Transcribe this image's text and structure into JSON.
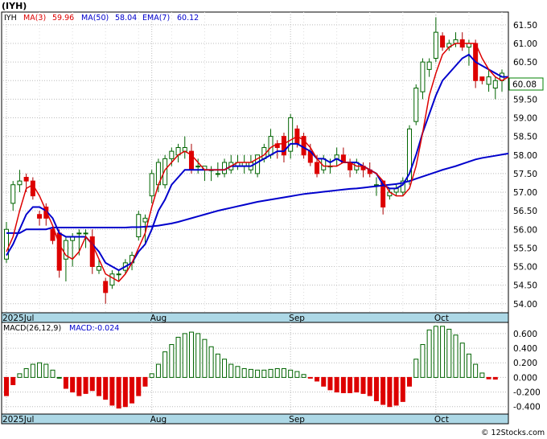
{
  "chart_data": [
    {
      "type": "candlestick",
      "title": "(IYH)",
      "indicators": {
        "symbol": "IYH",
        "ma3_label": "MA(3)",
        "ma3_value": "59.96",
        "ma50_label": "MA(50)",
        "ma50_value": "58.04",
        "ema7_label": "EMA(7)",
        "ema7_value": "60.12"
      },
      "last_price_label": "60.08",
      "x_labels": [
        "2025Jul",
        "Aug",
        "Sep",
        "Oct"
      ],
      "ylim": [
        53.8,
        61.8
      ],
      "yticks": [
        "61.50",
        "61.00",
        "60.50",
        "60.00",
        "59.50",
        "59.00",
        "58.50",
        "58.00",
        "57.50",
        "57.00",
        "56.50",
        "56.00",
        "55.50",
        "55.00",
        "54.50",
        "54.00"
      ],
      "colors": {
        "up": "#006400",
        "down": "#dd0000",
        "ma3": "#dd0000",
        "ema7": "#0000cc",
        "ma50": "#0000cc",
        "accent": "#add8e6"
      },
      "candles": [
        {
          "date": "Jul 01",
          "open": 55.2,
          "high": 56.2,
          "low": 55.1,
          "close": 56.0
        },
        {
          "date": "Jul 02",
          "open": 56.7,
          "high": 57.3,
          "low": 56.5,
          "close": 57.2
        },
        {
          "date": "Jul 03",
          "open": 57.2,
          "high": 57.6,
          "low": 57.0,
          "close": 57.3
        },
        {
          "date": "Jul 07",
          "open": 57.4,
          "high": 57.5,
          "low": 57.0,
          "close": 57.3
        },
        {
          "date": "Jul 08",
          "open": 57.3,
          "high": 57.4,
          "low": 56.8,
          "close": 56.9
        },
        {
          "date": "Jul 09",
          "open": 56.4,
          "high": 56.5,
          "low": 56.1,
          "close": 56.3
        },
        {
          "date": "Jul 10",
          "open": 56.6,
          "high": 56.7,
          "low": 56.1,
          "close": 56.3
        },
        {
          "date": "Jul 11",
          "open": 56.0,
          "high": 56.1,
          "low": 55.6,
          "close": 55.7
        },
        {
          "date": "Jul 14",
          "open": 55.9,
          "high": 56.0,
          "low": 54.7,
          "close": 54.9
        },
        {
          "date": "Jul 15",
          "open": 55.2,
          "high": 55.8,
          "low": 54.6,
          "close": 55.7
        },
        {
          "date": "Jul 16",
          "open": 55.7,
          "high": 55.9,
          "low": 55.0,
          "close": 55.8
        },
        {
          "date": "Jul 17",
          "open": 55.9,
          "high": 56.0,
          "low": 55.3,
          "close": 55.9
        },
        {
          "date": "Jul 18",
          "open": 55.9,
          "high": 56.0,
          "low": 55.5,
          "close": 55.9
        },
        {
          "date": "Jul 21",
          "open": 55.8,
          "high": 56.0,
          "low": 54.8,
          "close": 55.0
        },
        {
          "date": "Jul 22",
          "open": 54.9,
          "high": 55.2,
          "low": 54.8,
          "close": 55.0
        },
        {
          "date": "Jul 23",
          "open": 54.6,
          "high": 54.7,
          "low": 54.0,
          "close": 54.3
        },
        {
          "date": "Jul 24",
          "open": 54.5,
          "high": 54.9,
          "low": 54.4,
          "close": 54.8
        },
        {
          "date": "Jul 25",
          "open": 54.8,
          "high": 54.9,
          "low": 54.6,
          "close": 54.8
        },
        {
          "date": "Jul 28",
          "open": 54.9,
          "high": 55.2,
          "low": 54.8,
          "close": 55.1
        },
        {
          "date": "Jul 29",
          "open": 55.1,
          "high": 55.4,
          "low": 54.9,
          "close": 55.3
        },
        {
          "date": "Jul 30",
          "open": 55.8,
          "high": 56.5,
          "low": 55.7,
          "close": 56.4
        },
        {
          "date": "Jul 31",
          "open": 56.2,
          "high": 56.4,
          "low": 55.6,
          "close": 56.3
        },
        {
          "date": "Aug 01",
          "open": 56.9,
          "high": 57.6,
          "low": 56.7,
          "close": 57.5
        },
        {
          "date": "Aug 04",
          "open": 57.2,
          "high": 57.9,
          "low": 57.0,
          "close": 57.8
        },
        {
          "date": "Aug 05",
          "open": 57.2,
          "high": 58.0,
          "low": 57.1,
          "close": 57.9
        },
        {
          "date": "Aug 06",
          "open": 57.9,
          "high": 58.2,
          "low": 57.7,
          "close": 58.1
        },
        {
          "date": "Aug 07",
          "open": 58.0,
          "high": 58.3,
          "low": 57.8,
          "close": 58.2
        },
        {
          "date": "Aug 08",
          "open": 58.1,
          "high": 58.5,
          "low": 57.9,
          "close": 58.2
        },
        {
          "date": "Aug 11",
          "open": 58.1,
          "high": 58.3,
          "low": 57.5,
          "close": 57.6
        },
        {
          "date": "Aug 12",
          "open": 57.7,
          "high": 57.9,
          "low": 57.5,
          "close": 57.7
        },
        {
          "date": "Aug 13",
          "open": 57.6,
          "high": 57.7,
          "low": 57.3,
          "close": 57.7
        },
        {
          "date": "Aug 14",
          "open": 57.6,
          "high": 57.7,
          "low": 57.3,
          "close": 57.6
        },
        {
          "date": "Aug 15",
          "open": 57.5,
          "high": 57.8,
          "low": 57.4,
          "close": 57.5
        },
        {
          "date": "Aug 18",
          "open": 57.5,
          "high": 57.9,
          "low": 57.4,
          "close": 57.8
        },
        {
          "date": "Aug 19",
          "open": 57.6,
          "high": 58.0,
          "low": 57.5,
          "close": 57.8
        },
        {
          "date": "Aug 20",
          "open": 57.7,
          "high": 58.0,
          "low": 57.6,
          "close": 57.8
        },
        {
          "date": "Aug 21",
          "open": 57.7,
          "high": 58.0,
          "low": 57.5,
          "close": 57.8
        },
        {
          "date": "Aug 22",
          "open": 57.6,
          "high": 58.0,
          "low": 57.5,
          "close": 57.8
        },
        {
          "date": "Aug 25",
          "open": 57.5,
          "high": 58.0,
          "low": 57.4,
          "close": 58.0
        },
        {
          "date": "Aug 26",
          "open": 57.9,
          "high": 58.3,
          "low": 57.8,
          "close": 58.2
        },
        {
          "date": "Aug 27",
          "open": 58.0,
          "high": 58.7,
          "low": 57.9,
          "close": 58.5
        },
        {
          "date": "Aug 28",
          "open": 58.3,
          "high": 58.4,
          "low": 57.9,
          "close": 58.2
        },
        {
          "date": "Aug 29",
          "open": 58.5,
          "high": 58.6,
          "low": 57.8,
          "close": 58.0
        },
        {
          "date": "Sep 02",
          "open": 58.1,
          "high": 59.1,
          "low": 57.9,
          "close": 59.0
        },
        {
          "date": "Sep 03",
          "open": 58.7,
          "high": 58.8,
          "low": 58.2,
          "close": 58.3
        },
        {
          "date": "Sep 04",
          "open": 58.5,
          "high": 58.6,
          "low": 57.9,
          "close": 58.0
        },
        {
          "date": "Sep 05",
          "open": 58.1,
          "high": 58.3,
          "low": 57.7,
          "close": 57.8
        },
        {
          "date": "Sep 08",
          "open": 57.8,
          "high": 58.0,
          "low": 57.4,
          "close": 57.5
        },
        {
          "date": "Sep 09",
          "open": 57.6,
          "high": 58.0,
          "low": 57.5,
          "close": 57.9
        },
        {
          "date": "Sep 10",
          "open": 57.7,
          "high": 57.9,
          "low": 57.5,
          "close": 57.7
        },
        {
          "date": "Sep 11",
          "open": 57.9,
          "high": 58.2,
          "low": 57.7,
          "close": 58.0
        },
        {
          "date": "Sep 12",
          "open": 58.0,
          "high": 58.2,
          "low": 57.8,
          "close": 57.8
        },
        {
          "date": "Sep 15",
          "open": 57.8,
          "high": 57.9,
          "low": 57.4,
          "close": 57.6
        },
        {
          "date": "Sep 16",
          "open": 57.6,
          "high": 57.9,
          "low": 57.5,
          "close": 57.8
        },
        {
          "date": "Sep 17",
          "open": 57.7,
          "high": 57.8,
          "low": 57.4,
          "close": 57.6
        },
        {
          "date": "Sep 18",
          "open": 57.6,
          "high": 57.8,
          "low": 57.4,
          "close": 57.5
        },
        {
          "date": "Sep 19",
          "open": 57.2,
          "high": 57.4,
          "low": 56.9,
          "close": 57.2
        },
        {
          "date": "Sep 22",
          "open": 57.3,
          "high": 57.3,
          "low": 56.4,
          "close": 56.6
        },
        {
          "date": "Sep 23",
          "open": 56.9,
          "high": 57.1,
          "low": 56.8,
          "close": 57.0
        },
        {
          "date": "Sep 24",
          "open": 57.0,
          "high": 57.2,
          "low": 56.9,
          "close": 57.1
        },
        {
          "date": "Sep 25",
          "open": 57.0,
          "high": 57.4,
          "low": 56.9,
          "close": 57.3
        },
        {
          "date": "Sep 26",
          "open": 57.3,
          "high": 58.8,
          "low": 57.2,
          "close": 58.7
        },
        {
          "date": "Sep 29",
          "open": 58.9,
          "high": 59.9,
          "low": 58.8,
          "close": 59.8
        },
        {
          "date": "Sep 30",
          "open": 59.7,
          "high": 60.6,
          "low": 59.5,
          "close": 60.5
        },
        {
          "date": "Oct 01",
          "open": 60.3,
          "high": 60.6,
          "low": 60.1,
          "close": 60.5
        },
        {
          "date": "Oct 02",
          "open": 60.6,
          "high": 61.7,
          "low": 60.5,
          "close": 61.3
        },
        {
          "date": "Oct 03",
          "open": 61.2,
          "high": 61.3,
          "low": 60.8,
          "close": 60.9
        },
        {
          "date": "Oct 06",
          "open": 60.9,
          "high": 61.1,
          "low": 60.8,
          "close": 61.0
        },
        {
          "date": "Oct 07",
          "open": 61.0,
          "high": 61.3,
          "low": 60.9,
          "close": 61.1
        },
        {
          "date": "Oct 08",
          "open": 61.1,
          "high": 61.3,
          "low": 60.8,
          "close": 60.9
        },
        {
          "date": "Oct 09",
          "open": 60.9,
          "high": 61.1,
          "low": 60.4,
          "close": 61.0
        },
        {
          "date": "Oct 10",
          "open": 61.0,
          "high": 61.1,
          "low": 59.8,
          "close": 60.0
        },
        {
          "date": "Oct 13",
          "open": 60.1,
          "high": 60.1,
          "low": 59.9,
          "close": 60.0
        },
        {
          "date": "Oct 14",
          "open": 59.9,
          "high": 60.3,
          "low": 59.7,
          "close": 60.1
        },
        {
          "date": "Oct 15",
          "open": 59.8,
          "high": 60.1,
          "low": 59.5,
          "close": 60.0
        },
        {
          "date": "Oct 16",
          "open": 60.0,
          "high": 60.3,
          "low": 59.7,
          "close": 60.2
        }
      ],
      "ma3_series": [
        55.4,
        55.8,
        56.5,
        57.1,
        57.2,
        56.9,
        56.5,
        56.1,
        55.6,
        55.3,
        55.2,
        55.4,
        55.8,
        55.6,
        55.2,
        54.8,
        54.7,
        54.6,
        54.8,
        55.1,
        55.5,
        55.9,
        56.6,
        57.2,
        57.6,
        57.8,
        58.0,
        58.1,
        58.0,
        57.8,
        57.6,
        57.6,
        57.6,
        57.6,
        57.7,
        57.8,
        57.8,
        57.8,
        57.9,
        58.0,
        58.2,
        58.3,
        58.3,
        58.4,
        58.5,
        58.4,
        58.2,
        57.9,
        57.7,
        57.7,
        57.7,
        57.8,
        57.8,
        57.7,
        57.7,
        57.6,
        57.5,
        57.3,
        57.0,
        56.9,
        56.9,
        57.1,
        57.7,
        58.6,
        59.6,
        60.2,
        60.7,
        60.9,
        61.0,
        61.0,
        61.0,
        61.0,
        60.6,
        60.3,
        60.1,
        60.0,
        60.1
      ],
      "ema7_series": [
        55.3,
        55.6,
        56.0,
        56.4,
        56.6,
        56.6,
        56.5,
        56.3,
        55.9,
        55.8,
        55.8,
        55.8,
        55.8,
        55.6,
        55.4,
        55.1,
        55.0,
        54.9,
        55.0,
        55.1,
        55.4,
        55.6,
        56.0,
        56.5,
        56.8,
        57.2,
        57.4,
        57.6,
        57.6,
        57.6,
        57.6,
        57.6,
        57.6,
        57.6,
        57.7,
        57.7,
        57.7,
        57.7,
        57.8,
        57.9,
        58.0,
        58.1,
        58.1,
        58.3,
        58.3,
        58.2,
        58.1,
        57.9,
        57.9,
        57.8,
        57.9,
        57.8,
        57.8,
        57.8,
        57.7,
        57.6,
        57.5,
        57.2,
        57.1,
        57.1,
        57.2,
        57.5,
        58.0,
        58.6,
        59.1,
        59.6,
        60.0,
        60.2,
        60.4,
        60.6,
        60.7,
        60.5,
        60.4,
        60.3,
        60.2,
        60.1,
        60.1
      ],
      "ma50_series": [
        55.9,
        55.9,
        55.9,
        56.0,
        56.0,
        56.0,
        56.0,
        56.05,
        56.05,
        56.05,
        56.05,
        56.05,
        56.05,
        56.05,
        56.05,
        56.05,
        56.05,
        56.05,
        56.05,
        56.06,
        56.06,
        56.07,
        56.08,
        56.1,
        56.13,
        56.16,
        56.2,
        56.25,
        56.3,
        56.35,
        56.4,
        56.45,
        56.5,
        56.54,
        56.58,
        56.62,
        56.66,
        56.7,
        56.74,
        56.77,
        56.8,
        56.83,
        56.86,
        56.89,
        56.92,
        56.95,
        56.97,
        56.99,
        57.01,
        57.03,
        57.05,
        57.07,
        57.09,
        57.1,
        57.12,
        57.14,
        57.16,
        57.18,
        57.2,
        57.22,
        57.25,
        57.3,
        57.36,
        57.42,
        57.48,
        57.54,
        57.6,
        57.65,
        57.7,
        57.76,
        57.82,
        57.88,
        57.92,
        57.95,
        57.98,
        58.01,
        58.04
      ]
    },
    {
      "type": "bar",
      "title": "MACD(26,12,9)",
      "value_label": "MACD:-0.024",
      "ylim": [
        -0.48,
        0.72
      ],
      "yticks": [
        "0.600",
        "0.400",
        "0.200",
        "0.000",
        "-0.200",
        "-0.400"
      ],
      "values": [
        -0.25,
        -0.1,
        0.05,
        0.12,
        0.18,
        0.2,
        0.18,
        0.1,
        0.0,
        -0.15,
        -0.2,
        -0.25,
        -0.22,
        -0.18,
        -0.25,
        -0.3,
        -0.38,
        -0.42,
        -0.4,
        -0.35,
        -0.25,
        -0.12,
        0.05,
        0.18,
        0.35,
        0.45,
        0.55,
        0.6,
        0.62,
        0.6,
        0.52,
        0.42,
        0.32,
        0.25,
        0.18,
        0.15,
        0.12,
        0.11,
        0.1,
        0.1,
        0.11,
        0.12,
        0.12,
        0.1,
        0.08,
        0.04,
        -0.01,
        -0.05,
        -0.12,
        -0.17,
        -0.2,
        -0.21,
        -0.21,
        -0.2,
        -0.22,
        -0.25,
        -0.32,
        -0.37,
        -0.4,
        -0.38,
        -0.33,
        -0.12,
        0.25,
        0.45,
        0.65,
        0.7,
        0.7,
        0.66,
        0.58,
        0.47,
        0.32,
        0.18,
        0.06,
        -0.02,
        -0.024
      ]
    }
  ],
  "credit": "© 12Stocks.com"
}
